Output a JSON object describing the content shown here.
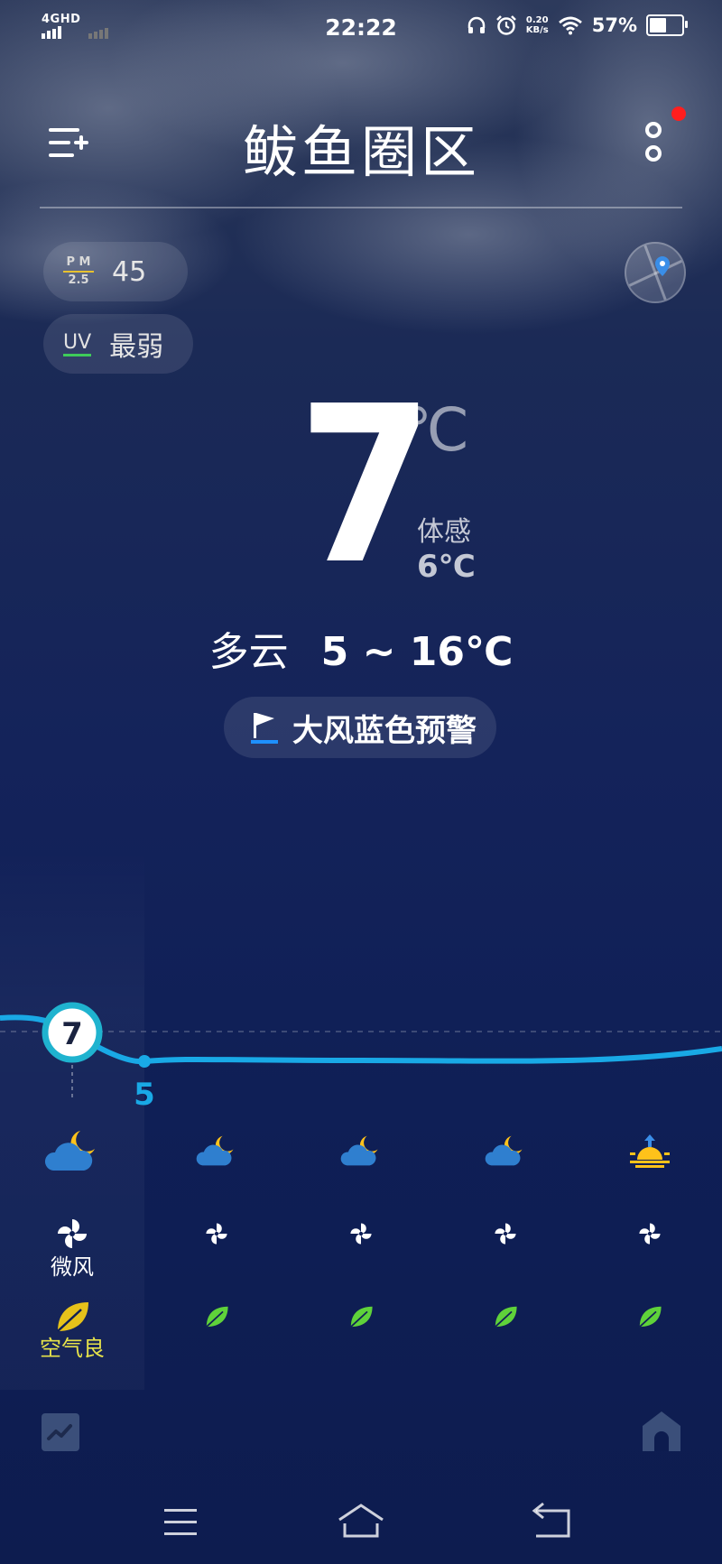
{
  "status_bar": {
    "network": "4GHD",
    "time": "22:22",
    "speed_value": "0.20",
    "speed_unit": "KB/s",
    "battery": "57%",
    "battery_level": 0.57,
    "icons": [
      "signal-icon",
      "headphones-icon",
      "alarm-icon",
      "wifi-icon",
      "battery-icon"
    ]
  },
  "header": {
    "city": "鲅鱼圈区",
    "menu_icon": "add-city-icon",
    "more_icon": "more-icon",
    "has_notification": true
  },
  "indices": {
    "pm_tag_top": "P M",
    "pm_tag_bottom": "2.5",
    "pm_value": "45",
    "uv_tag": "UV",
    "uv_value": "最弱"
  },
  "current": {
    "temperature": "7",
    "unit": "℃",
    "feels_label": "体感",
    "feels_value": "6℃",
    "condition": "多云",
    "range": "5 ~ 16℃"
  },
  "alert": {
    "text": "大风蓝色预警",
    "icon": "warning-flag-icon"
  },
  "hourly": {
    "temps": [
      7,
      5
    ],
    "temp_label_now": "7",
    "temp_label_next": "5",
    "weather_icons": [
      "cloudy-night-icon",
      "cloudy-night-icon",
      "cloudy-night-icon",
      "cloudy-night-icon",
      "sunrise-icon"
    ],
    "wind_label": "微风",
    "aq_label": "空气良"
  },
  "bottom": {
    "trend_icon": "trend-chart-icon",
    "home_icon": "home-icon"
  },
  "nav": {
    "icons": [
      "menu-nav-icon",
      "home-nav-icon",
      "back-nav-icon"
    ]
  },
  "colors": {
    "accent": "#19a9e6",
    "alert_blue": "#1e90ff",
    "sun_yellow": "#ffc21a",
    "leaf_green": "#5fd23a",
    "aq_yellow": "#e6e24a"
  }
}
